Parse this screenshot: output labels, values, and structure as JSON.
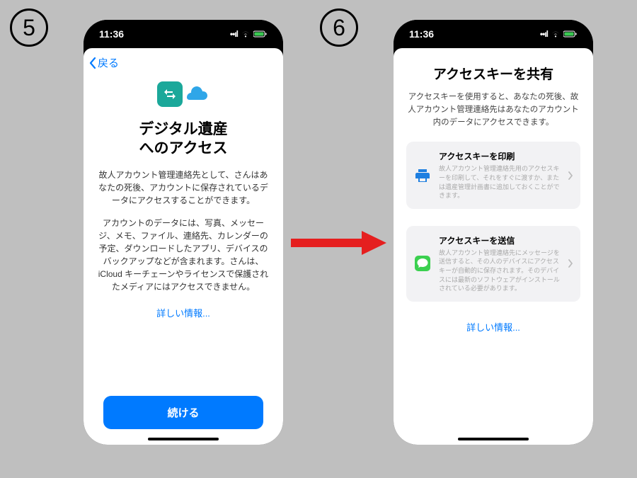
{
  "step_labels": {
    "five": "5",
    "six": "6"
  },
  "status": {
    "time": "11:36"
  },
  "screen1": {
    "back": "戻る",
    "title_line1": "デジタル遺産",
    "title_line2": "へのアクセス",
    "desc1": "故人アカウント管理連絡先として、さんはあなたの死後、アカウントに保存されているデータにアクセスすることができます。",
    "desc2": "アカウントのデータには、写真、メッセージ、メモ、ファイル、連絡先、カレンダーの予定、ダウンロードしたアプリ、デバイスのバックアップなどが含まれます。さんは、iCloud キーチェーンやライセンスで保護されたメディアにはアクセスできません。",
    "more_info": "詳しい情報...",
    "continue": "続ける"
  },
  "screen2": {
    "title": "アクセスキーを共有",
    "desc": "アクセスキーを使用すると、あなたの死後、故人アカウント管理連絡先はあなたのアカウント内のデータにアクセスできます。",
    "option1": {
      "title": "アクセスキーを印刷",
      "desc": "故人アカウント管理連絡先用のアクセスキーを印刷して、それをすぐに渡すか、または遺産管理計画書に追加しておくことができます。"
    },
    "option2": {
      "title": "アクセスキーを送信",
      "desc": "故人アカウント管理連絡先にメッセージを送信すると、その人のデバイスにアクセスキーが自動的に保存されます。そのデバイスには最新のソフトウェアがインストールされている必要があります。"
    },
    "more_info": "詳しい情報..."
  }
}
